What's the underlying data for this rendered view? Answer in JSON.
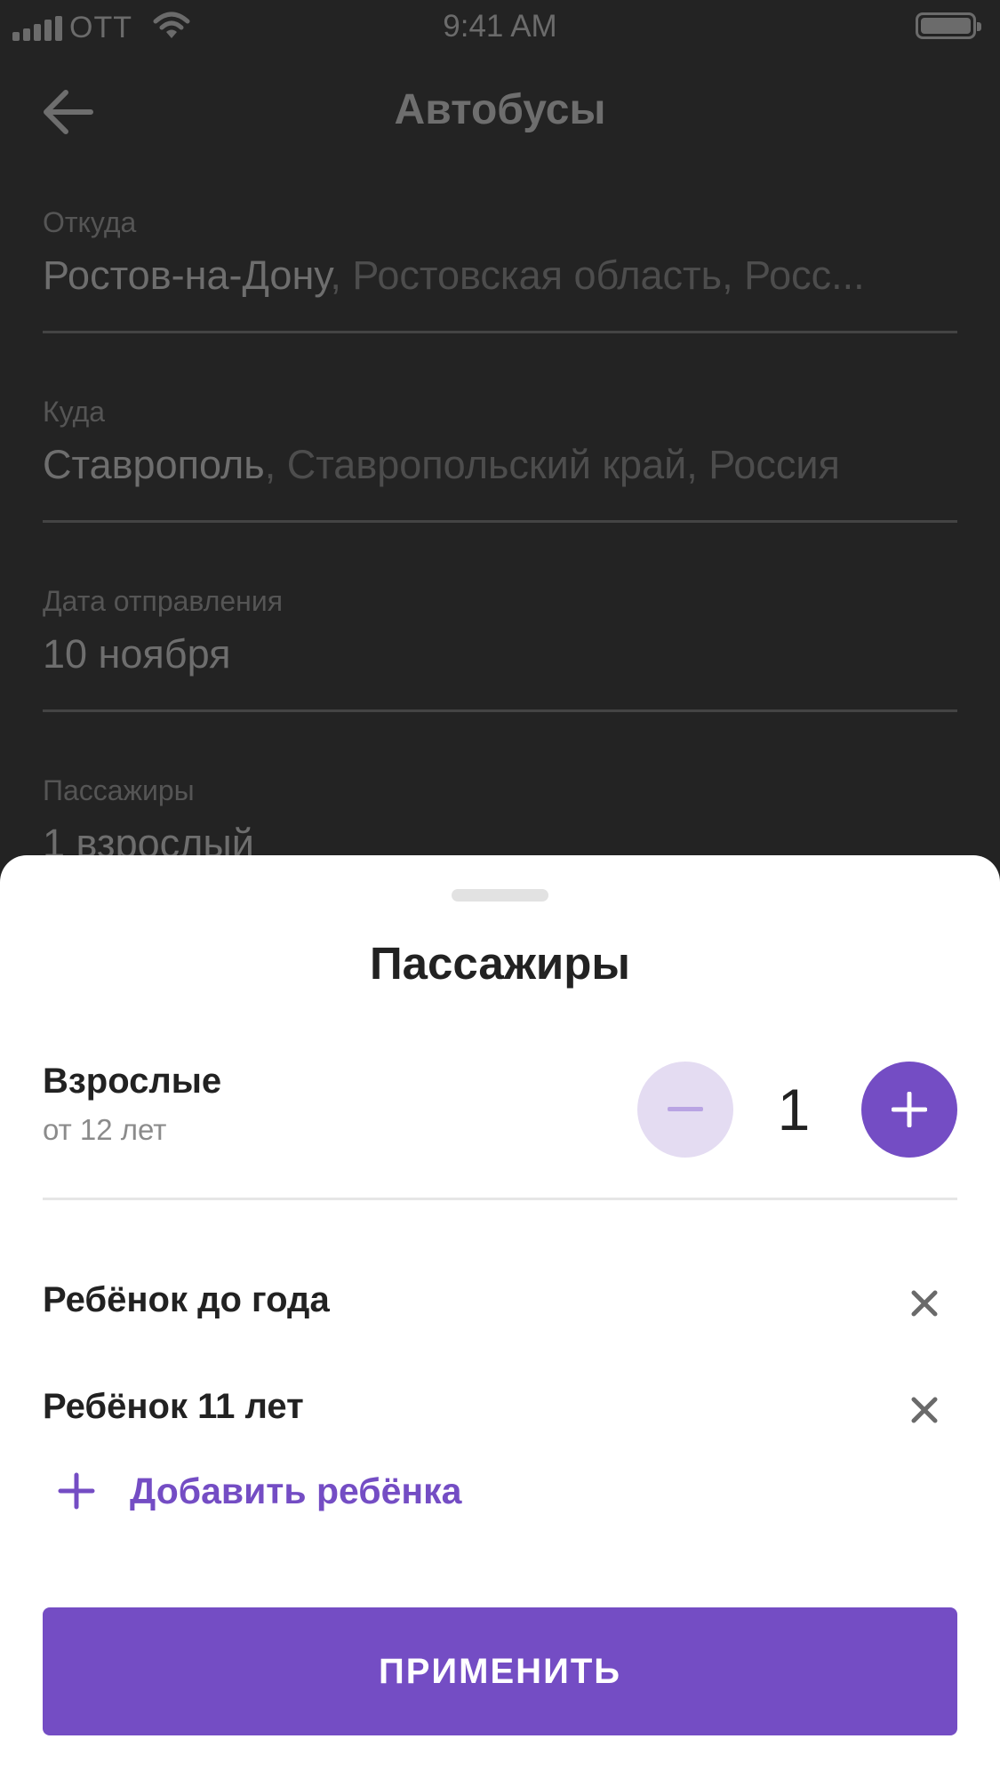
{
  "status_bar": {
    "carrier": "OTT",
    "time": "9:41 AM"
  },
  "nav": {
    "title": "Автобусы"
  },
  "form": {
    "from": {
      "label": "Откуда",
      "value": "Ростов-на-Дону",
      "detail": ", Ростовская область, Росс..."
    },
    "to": {
      "label": "Куда",
      "value": "Ставрополь",
      "detail": ", Ставропольский край, Россия"
    },
    "date": {
      "label": "Дата отправления",
      "value": "10 ноября"
    },
    "passengers": {
      "label": "Пассажиры",
      "value": "1 взрослый"
    }
  },
  "sheet": {
    "title": "Пассажиры",
    "adults": {
      "label": "Взрослые",
      "subtitle": "от 12 лет",
      "count": "1"
    },
    "children": [
      {
        "label": "Ребёнок до года"
      },
      {
        "label": "Ребёнок 11 лет"
      }
    ],
    "add_child_label": "Добавить ребёнка",
    "apply_label": "ПРИМЕНИТЬ"
  },
  "colors": {
    "accent": "#744dc4",
    "accent_light": "#e4dcf2",
    "dim_background": "#232323"
  },
  "icons": {
    "back": "arrow-left-icon",
    "minus": "minus-icon",
    "plus": "plus-icon",
    "remove": "close-icon",
    "add": "plus-icon"
  }
}
